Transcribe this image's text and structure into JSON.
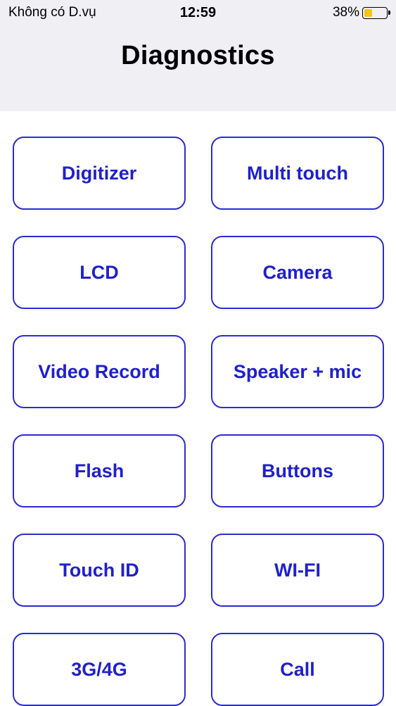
{
  "status_bar": {
    "carrier": "Không có D.vụ",
    "time": "12:59",
    "battery_percent": "38%",
    "battery_level": 0.38,
    "battery_color": "#f5c518"
  },
  "header": {
    "title": "Diagnostics"
  },
  "buttons": [
    "Digitizer",
    "Multi touch",
    "LCD",
    "Camera",
    "Video Record",
    "Speaker + mic",
    "Flash",
    "Buttons",
    "Touch ID",
    "WI-FI",
    "3G/4G",
    "Call"
  ],
  "colors": {
    "accent": "#2020cc",
    "header_background": "#efeff4"
  }
}
